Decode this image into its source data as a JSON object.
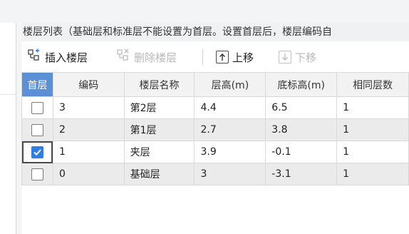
{
  "title_bar": {
    "text": "楼层列表（基础层和标准层不能设置为首层。设置首层后，楼层编码自"
  },
  "toolbar": {
    "insert_label": "插入楼层",
    "delete_label": "删除楼层",
    "move_up_label": "上移",
    "move_down_label": "下移"
  },
  "table": {
    "headers": [
      "首层",
      "编码",
      "楼层名称",
      "层高(m)",
      "底标高(m)",
      "相同层数"
    ],
    "rows": [
      {
        "first_floor": false,
        "code": "3",
        "name": "第2层",
        "height": "4.4",
        "base_elev": "6.5",
        "same_count": "1"
      },
      {
        "first_floor": false,
        "code": "2",
        "name": "第1层",
        "height": "2.7",
        "base_elev": "3.8",
        "same_count": "1"
      },
      {
        "first_floor": true,
        "code": "1",
        "name": "夹层",
        "height": "3.9",
        "base_elev": "-0.1",
        "same_count": "1"
      },
      {
        "first_floor": false,
        "code": "0",
        "name": "基础层",
        "height": "3",
        "base_elev": "-3.1",
        "same_count": "1"
      }
    ]
  },
  "colors": {
    "header_selected": "#5b8fd6",
    "checkbox_checked": "#2f7ee0",
    "alt_row": "#ebebeb"
  }
}
